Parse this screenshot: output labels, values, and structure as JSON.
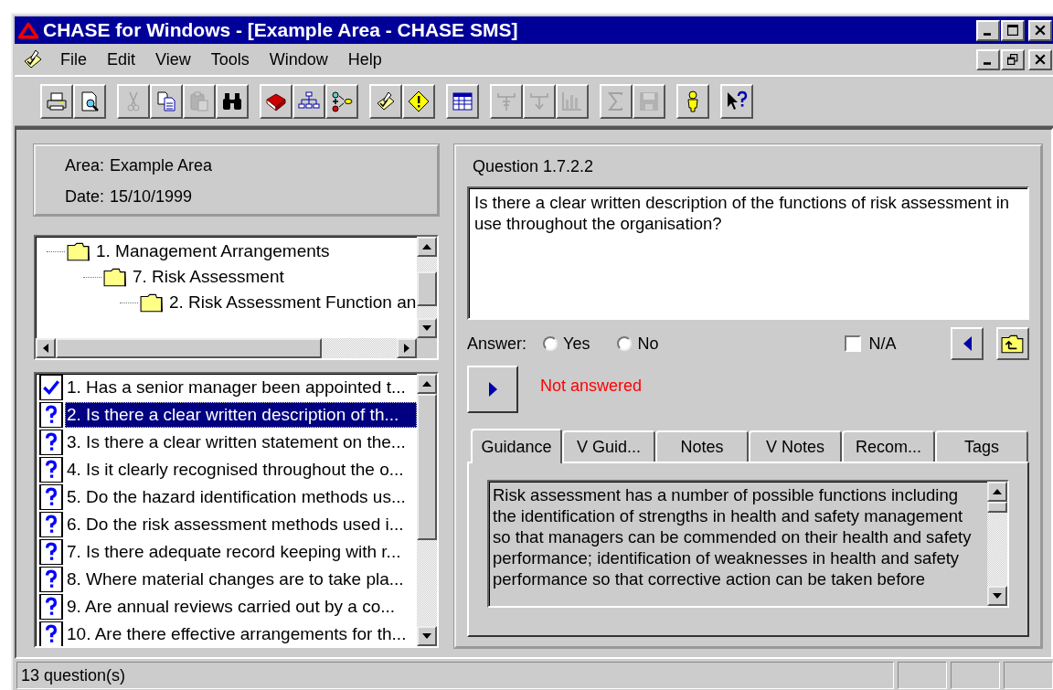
{
  "window": {
    "title": "CHASE for Windows - [Example Area - CHASE SMS]"
  },
  "menu": [
    "File",
    "Edit",
    "View",
    "Tools",
    "Window",
    "Help"
  ],
  "toolbar": {
    "groups": [
      [
        {
          "kind": "print",
          "disabled": false
        },
        {
          "kind": "preview",
          "disabled": false
        }
      ],
      [
        {
          "kind": "cut",
          "disabled": true
        },
        {
          "kind": "copy",
          "disabled": false
        },
        {
          "kind": "paste",
          "disabled": true
        },
        {
          "kind": "find",
          "disabled": false
        }
      ],
      [
        {
          "kind": "book",
          "disabled": false
        },
        {
          "kind": "hierarchy",
          "disabled": false
        },
        {
          "kind": "flow",
          "disabled": false
        }
      ],
      [
        {
          "kind": "checklist",
          "disabled": false
        },
        {
          "kind": "warning",
          "disabled": false
        }
      ],
      [
        {
          "kind": "table",
          "disabled": false
        }
      ],
      [
        {
          "kind": "tree-up",
          "disabled": true
        },
        {
          "kind": "tree-down",
          "disabled": true
        },
        {
          "kind": "chart",
          "disabled": true
        }
      ],
      [
        {
          "kind": "sum",
          "disabled": true
        },
        {
          "kind": "save",
          "disabled": true
        }
      ],
      [
        {
          "kind": "person",
          "disabled": false
        }
      ],
      [
        {
          "kind": "help",
          "disabled": false
        }
      ]
    ]
  },
  "info": {
    "area_label": "Area:",
    "area": "Example Area",
    "date_label": "Date:",
    "date": "15/10/1999"
  },
  "tree": [
    {
      "label": "1. Management Arrangements",
      "children": [
        {
          "label": "7. Risk Assessment",
          "children": [
            {
              "label": "2. Risk Assessment Function an"
            }
          ]
        }
      ]
    }
  ],
  "questions": [
    {
      "label": "1. Has a senior manager been appointed t...",
      "answered": true,
      "selected": false
    },
    {
      "label": "2. Is there a clear written description of th...",
      "answered": false,
      "selected": true
    },
    {
      "label": "3. Is there a clear written statement on the...",
      "answered": false,
      "selected": false
    },
    {
      "label": "4. Is it clearly recognised throughout the o...",
      "answered": false,
      "selected": false
    },
    {
      "label": "5. Do the hazard identification methods us...",
      "answered": false,
      "selected": false
    },
    {
      "label": "6. Do the risk assessment methods used i...",
      "answered": false,
      "selected": false
    },
    {
      "label": "7. Is there adequate record keeping with r...",
      "answered": false,
      "selected": false
    },
    {
      "label": "8. Where material changes are to take pla...",
      "answered": false,
      "selected": false
    },
    {
      "label": "9. Are annual reviews carried out by a co...",
      "answered": false,
      "selected": false
    },
    {
      "label": "10. Are there effective arrangements for th...",
      "answered": false,
      "selected": false
    }
  ],
  "question": {
    "title": "Question 1.7.2.2",
    "text": "Is there a clear written description of the functions of risk assessment in use throughout the organisation?"
  },
  "answer": {
    "label": "Answer:",
    "options": [
      {
        "label": "Yes",
        "selected": false
      },
      {
        "label": "No",
        "selected": false
      }
    ],
    "na": {
      "label": "N/A",
      "checked": false
    },
    "status": "Not answered"
  },
  "tabs": [
    {
      "label": "Guidance",
      "selected": true
    },
    {
      "label": "V Guid...",
      "selected": false
    },
    {
      "label": "Notes",
      "selected": false
    },
    {
      "label": "V  Notes",
      "selected": false
    },
    {
      "label": "Recom...",
      "selected": false
    },
    {
      "label": "Tags",
      "selected": false
    }
  ],
  "guidance": "Risk assessment has a number of possible functions including the identification of strengths in health and safety management so that managers can be commended on their health and safety performance; identification of weaknesses in health and safety performance so that corrective action can be taken before",
  "status_bar": {
    "text": "13 question(s)"
  }
}
